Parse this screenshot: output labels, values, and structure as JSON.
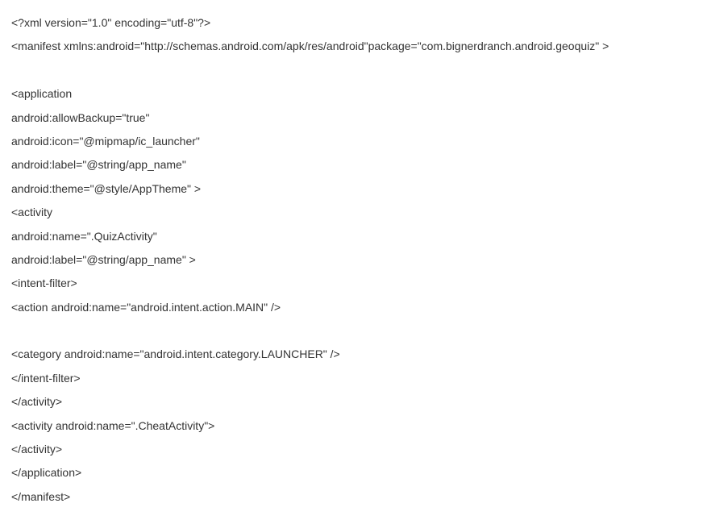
{
  "lines": [
    "<?xml version=\"1.0\" encoding=\"utf-8\"?>",
    "<manifest xmlns:android=\"http://schemas.android.com/apk/res/android\"package=\"com.bignerdranch.android.geoquiz\" >",
    "",
    "<application",
    "android:allowBackup=\"true\"",
    "android:icon=\"@mipmap/ic_launcher\"",
    "android:label=\"@string/app_name\"",
    "android:theme=\"@style/AppTheme\" >",
    "<activity",
    "android:name=\".QuizActivity\"",
    "android:label=\"@string/app_name\" >",
    "<intent-filter>",
    "<action android:name=\"android.intent.action.MAIN\" />",
    "",
    "<category android:name=\"android.intent.category.LAUNCHER\" />",
    "</intent-filter>",
    "</activity>",
    "<activity android:name=\".CheatActivity\">",
    "</activity>",
    "</application>",
    "</manifest>"
  ]
}
